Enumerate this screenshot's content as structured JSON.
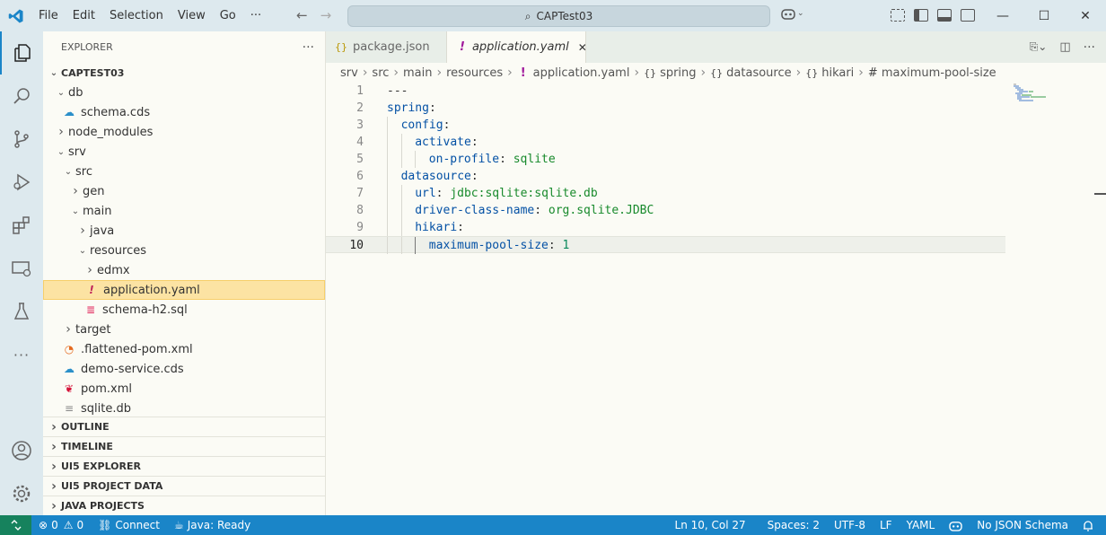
{
  "titlebar": {
    "menu": [
      "File",
      "Edit",
      "Selection",
      "View",
      "Go",
      "···"
    ],
    "search_text": "CAPTest03"
  },
  "explorer": {
    "header": "EXPLORER",
    "more": "···",
    "root": "CAPTEST03",
    "tree": [
      {
        "label": "db",
        "depth": 1,
        "kind": "folder-open",
        "icon": "chevron-down-icon"
      },
      {
        "label": "schema.cds",
        "depth": 2,
        "kind": "file",
        "icon": "cds-cloud-icon"
      },
      {
        "label": "node_modules",
        "depth": 1,
        "kind": "folder-closed",
        "icon": "chevron-right-icon"
      },
      {
        "label": "srv",
        "depth": 1,
        "kind": "folder-open",
        "icon": "chevron-down-icon"
      },
      {
        "label": "src",
        "depth": 2,
        "kind": "folder-open",
        "icon": "chevron-down-icon"
      },
      {
        "label": "gen",
        "depth": 3,
        "kind": "folder-closed",
        "icon": "chevron-right-icon"
      },
      {
        "label": "main",
        "depth": 3,
        "kind": "folder-open",
        "icon": "chevron-down-icon"
      },
      {
        "label": "java",
        "depth": 4,
        "kind": "folder-closed",
        "icon": "chevron-right-icon"
      },
      {
        "label": "resources",
        "depth": 4,
        "kind": "folder-open",
        "icon": "chevron-down-icon"
      },
      {
        "label": "edmx",
        "depth": 5,
        "kind": "folder-closed",
        "icon": "chevron-right-icon"
      },
      {
        "label": "application.yaml",
        "depth": 5,
        "kind": "file",
        "icon": "yaml-exclamation-icon",
        "selected": true
      },
      {
        "label": "schema-h2.sql",
        "depth": 5,
        "kind": "file",
        "icon": "database-icon"
      },
      {
        "label": "target",
        "depth": 2,
        "kind": "folder-closed",
        "icon": "chevron-right-icon"
      },
      {
        "label": ".flattened-pom.xml",
        "depth": 2,
        "kind": "file",
        "icon": "rss-icon"
      },
      {
        "label": "demo-service.cds",
        "depth": 2,
        "kind": "file",
        "icon": "cds-cloud-icon"
      },
      {
        "label": "pom.xml",
        "depth": 2,
        "kind": "file",
        "icon": "maven-feather-icon"
      },
      {
        "label": "sqlite.db",
        "depth": 2,
        "kind": "file",
        "icon": "text-file-icon"
      }
    ],
    "panels": [
      "OUTLINE",
      "TIMELINE",
      "UI5 EXPLORER",
      "UI5 PROJECT DATA",
      "JAVA PROJECTS"
    ]
  },
  "tabs": [
    {
      "label": "package.json",
      "icon": "{}",
      "active": false
    },
    {
      "label": "application.yaml",
      "icon": "!",
      "active": true,
      "close": "✕"
    }
  ],
  "breadcrumb": [
    {
      "label": "srv",
      "icon": ""
    },
    {
      "label": "src",
      "icon": ""
    },
    {
      "label": "main",
      "icon": ""
    },
    {
      "label": "resources",
      "icon": ""
    },
    {
      "label": "application.yaml",
      "icon": "!"
    },
    {
      "label": "spring",
      "icon": "{}"
    },
    {
      "label": "datasource",
      "icon": "{}"
    },
    {
      "label": "hikari",
      "icon": "{}"
    },
    {
      "label": "maximum-pool-size",
      "icon": "#"
    }
  ],
  "code": [
    {
      "n": "1",
      "indent": 0,
      "parts": [
        {
          "t": "---",
          "c": "p"
        }
      ]
    },
    {
      "n": "2",
      "indent": 0,
      "parts": [
        {
          "t": "spring",
          "c": "k"
        },
        {
          "t": ":",
          "c": "p"
        }
      ]
    },
    {
      "n": "3",
      "indent": 1,
      "parts": [
        {
          "t": "config",
          "c": "k"
        },
        {
          "t": ":",
          "c": "p"
        }
      ]
    },
    {
      "n": "4",
      "indent": 2,
      "parts": [
        {
          "t": "activate",
          "c": "k"
        },
        {
          "t": ":",
          "c": "p"
        }
      ]
    },
    {
      "n": "5",
      "indent": 3,
      "parts": [
        {
          "t": "on-profile",
          "c": "k"
        },
        {
          "t": ": ",
          "c": "p"
        },
        {
          "t": "sqlite",
          "c": "s"
        }
      ]
    },
    {
      "n": "6",
      "indent": 1,
      "parts": [
        {
          "t": "datasource",
          "c": "k"
        },
        {
          "t": ":",
          "c": "p"
        }
      ]
    },
    {
      "n": "7",
      "indent": 2,
      "parts": [
        {
          "t": "url",
          "c": "k"
        },
        {
          "t": ": ",
          "c": "p"
        },
        {
          "t": "jdbc:sqlite:sqlite.db",
          "c": "s"
        }
      ]
    },
    {
      "n": "8",
      "indent": 2,
      "parts": [
        {
          "t": "driver-class-name",
          "c": "k"
        },
        {
          "t": ": ",
          "c": "p"
        },
        {
          "t": "org.sqlite.JDBC",
          "c": "s"
        }
      ]
    },
    {
      "n": "9",
      "indent": 2,
      "parts": [
        {
          "t": "hikari",
          "c": "k"
        },
        {
          "t": ":",
          "c": "p"
        }
      ]
    },
    {
      "n": "10",
      "indent": 3,
      "parts": [
        {
          "t": "maximum-pool-size",
          "c": "k"
        },
        {
          "t": ": ",
          "c": "p"
        },
        {
          "t": "1",
          "c": "n"
        }
      ],
      "current": true
    }
  ],
  "statusbar": {
    "errors": "0",
    "warnings": "0",
    "connect": "Connect",
    "java": "Java: Ready",
    "position": "Ln 10, Col 27",
    "spaces": "Spaces: 2",
    "encoding": "UTF-8",
    "eol": "LF",
    "language": "YAML",
    "schema": "No JSON Schema"
  },
  "colors": {
    "accent": "#1a85c8",
    "remote": "#16825d",
    "selection": "#fce3a3"
  }
}
